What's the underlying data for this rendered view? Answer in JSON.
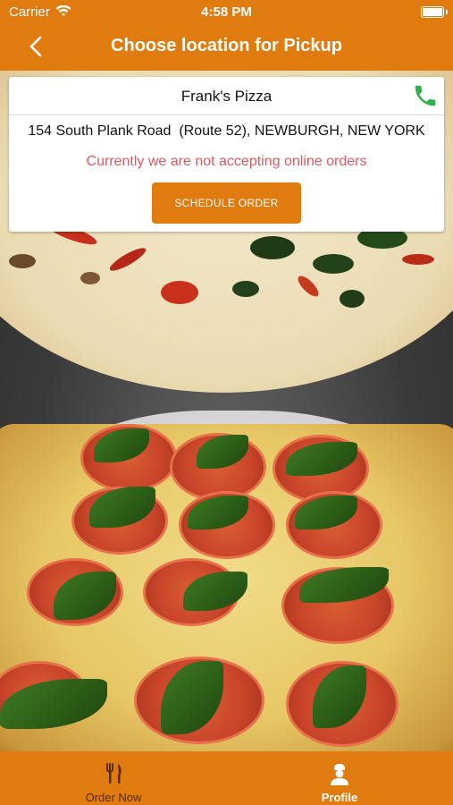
{
  "status_bar": {
    "carrier": "Carrier",
    "time": "4:58 PM",
    "icons": [
      "wifi-icon",
      "battery-icon"
    ]
  },
  "header": {
    "title": "Choose location for Pickup",
    "back_icon": "chevron-left-icon"
  },
  "location": {
    "name": "Frank's Pizza",
    "address": "154 South Plank Road  (Route 52), NEWBURGH, NEW YORK",
    "notice": "Currently we are not accepting online orders",
    "schedule_button": "SCHEDULE ORDER",
    "phone_icon": "phone-icon"
  },
  "tabbar": {
    "tabs": [
      {
        "label": "Order Now",
        "icon": "fork-knife-icon",
        "active": false
      },
      {
        "label": "Profile",
        "icon": "chef-profile-icon",
        "active": true
      }
    ]
  },
  "colors": {
    "brand": "#e07b10",
    "notice": "#e0595e",
    "phone": "#2fb24c",
    "inactive_tab_label": "#5a2a00"
  }
}
